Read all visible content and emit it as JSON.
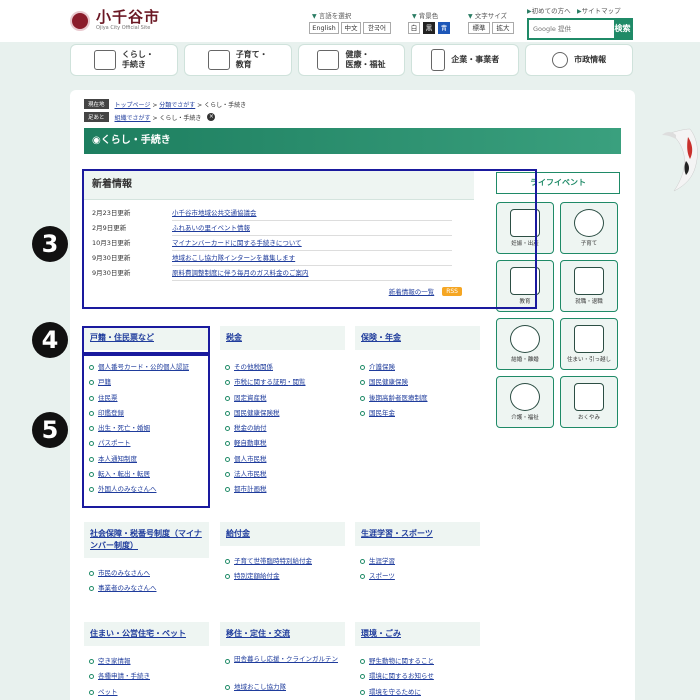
{
  "header": {
    "logo_title": "小千谷市",
    "logo_sub": "Ojiya City Official Site",
    "lang_label": "言語を選択",
    "lang_buttons": [
      "English",
      "中文",
      "한국어"
    ],
    "bg_label": "背景色",
    "bg_buttons": [
      "白",
      "黒",
      "青"
    ],
    "font_label": "文字サイズ",
    "font_buttons": [
      "標準",
      "拡大"
    ],
    "first_visit": "初めての方へ",
    "sitemap": "サイトマップ",
    "search_placeholder": "Google 提供",
    "search_button": "検索"
  },
  "nav": [
    "くらし・\n手続き",
    "子育て・\n教育",
    "健康・\n医療・福祉",
    "企業・事業者",
    "市政情報"
  ],
  "breadcrumb": {
    "current_tag": "現在地",
    "current_path": [
      "トップページ",
      "分類でさがす",
      "くらし・手続き"
    ],
    "trail_tag": "足あと",
    "trail_path": [
      "組織でさがす",
      "くらし・手続き"
    ]
  },
  "page_title": "くらし・手続き",
  "news": {
    "title": "新着情報",
    "rows": [
      {
        "date": "2月23日更新",
        "title": "小千谷市地域公共交通協議会"
      },
      {
        "date": "2月9日更新",
        "title": "ふれあいの里イベント情報"
      },
      {
        "date": "10月3日更新",
        "title": "マイナンバーカードに関する手続きについて"
      },
      {
        "date": "9月30日更新",
        "title": "地域おこし協力隊インターンを募集します"
      },
      {
        "date": "9月30日更新",
        "title": "原料費調整制度に伴う毎月のガス料金のご案内"
      }
    ],
    "list_link": "新着情報の一覧",
    "rss": "RSS"
  },
  "categories": [
    {
      "title": "戸籍・住民票など",
      "items": [
        "個人番号カード・公的個人認証",
        "戸籍",
        "住民票",
        "印鑑登録",
        "出生・死亡・婚姻",
        "パスポート",
        "本人通知制度",
        "転入・転出・転居",
        "外国人のみなさんへ"
      ]
    },
    {
      "title": "税金",
      "items": [
        "その他税関係",
        "市税に関する証明・閲覧",
        "固定資産税",
        "国民健康保険税",
        "税金の納付",
        "軽自動車税",
        "個人市民税",
        "法人市民税",
        "都市計画税"
      ]
    },
    {
      "title": "保険・年金",
      "items": [
        "介護保険",
        "国民健康保険",
        "後期高齢者医療制度",
        "国民年金"
      ]
    },
    {
      "title": "社会保障・税番号制度（マイナンバー制度）",
      "items": [
        "市民のみなさんへ",
        "事業者のみなさんへ"
      ]
    },
    {
      "title": "給付金",
      "items": [
        "子育て世帯臨時特別給付金",
        "特別定額給付金"
      ]
    },
    {
      "title": "生涯学習・スポーツ",
      "items": [
        "生涯学習",
        "スポーツ"
      ]
    },
    {
      "title": "住まい・公営住宅・ペット",
      "items": [
        "空き家情報",
        "各種申請・手続き",
        "ペット"
      ]
    },
    {
      "title": "移住・定住・交流",
      "items": [
        "田舎暮らし応援・クラインガルテン",
        "地域おこし協力隊"
      ]
    },
    {
      "title": "環境・ごみ",
      "items": [
        "野生動物に関すること",
        "環境に関するお知らせ",
        "環境を守るために"
      ]
    }
  ],
  "life_events": {
    "title": "ライフイベント",
    "items": [
      "妊娠・出産",
      "子育て",
      "教育",
      "就職・退職",
      "結婚・離婚",
      "住まい・引っ越し",
      "介護・福祉",
      "おくやみ"
    ]
  },
  "annotations": [
    "3",
    "4",
    "5"
  ]
}
